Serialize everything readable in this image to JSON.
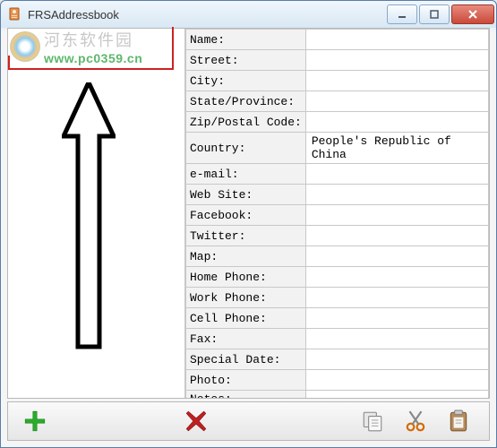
{
  "window": {
    "title": "FRSAddressbook"
  },
  "watermark": {
    "cn_text": "河东软件园",
    "url": "www.pc0359.cn"
  },
  "fields": [
    {
      "label": "Name:",
      "value": ""
    },
    {
      "label": "Street:",
      "value": ""
    },
    {
      "label": "City:",
      "value": ""
    },
    {
      "label": "State/Province:",
      "value": ""
    },
    {
      "label": "Zip/Postal Code:",
      "value": ""
    },
    {
      "label": "Country:",
      "value": "People's Republic of China"
    },
    {
      "label": "e-mail:",
      "value": ""
    },
    {
      "label": "Web Site:",
      "value": ""
    },
    {
      "label": "Facebook:",
      "value": ""
    },
    {
      "label": "Twitter:",
      "value": ""
    },
    {
      "label": "Map:",
      "value": ""
    },
    {
      "label": "Home Phone:",
      "value": ""
    },
    {
      "label": "Work Phone:",
      "value": ""
    },
    {
      "label": "Cell Phone:",
      "value": ""
    },
    {
      "label": "Fax:",
      "value": ""
    },
    {
      "label": "Special Date:",
      "value": ""
    },
    {
      "label": "Photo:",
      "value": ""
    },
    {
      "label": "Notes:",
      "value": ""
    }
  ],
  "toolbar": {
    "add": "Add",
    "delete": "Delete",
    "copy": "Copy",
    "cut": "Cut",
    "paste": "Paste"
  }
}
